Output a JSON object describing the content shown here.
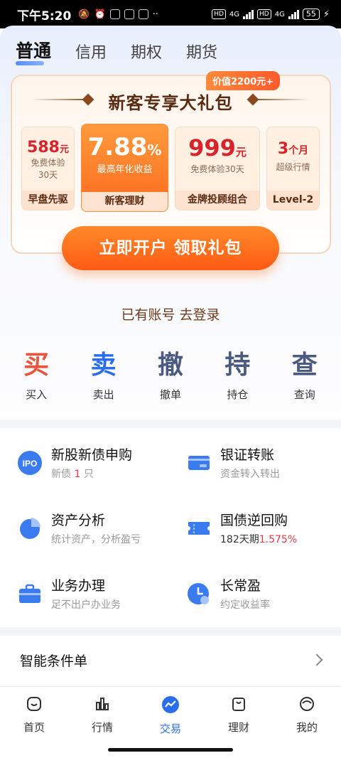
{
  "status": {
    "time": "下午5:20",
    "net1": "4G",
    "net2": "4G",
    "hd": "HD",
    "battery": "55"
  },
  "tabs": [
    {
      "label": "普通"
    },
    {
      "label": "信用"
    },
    {
      "label": "期权"
    },
    {
      "label": "期货"
    }
  ],
  "promo": {
    "badge": "价值2200元+",
    "title": "新客专享大礼包",
    "offers": [
      {
        "big": "588",
        "unit": "元",
        "sub1": "免费体验",
        "sub2": "30天",
        "foot": "早盘先驱"
      },
      {
        "big": "7.88",
        "unit": "%",
        "sub1": "最高年化收益",
        "sub2": "",
        "foot": "新客理财"
      },
      {
        "big": "999",
        "unit": "元",
        "sub1": "免费体验30天",
        "sub2": "",
        "foot": "金牌投顾组合"
      },
      {
        "big": "3",
        "unit": "个月",
        "sub1": "超级行情",
        "sub2": "",
        "foot": "Level-2"
      }
    ],
    "cta": "立即开户 领取礼包",
    "login": "已有账号 去登录"
  },
  "quick": [
    {
      "glyph": "买",
      "label": "买入",
      "color": "#e8553a"
    },
    {
      "glyph": "卖",
      "label": "卖出",
      "color": "#2a6ee8"
    },
    {
      "glyph": "撤",
      "label": "撤单",
      "color": "#4a5a80"
    },
    {
      "glyph": "持",
      "label": "持仓",
      "color": "#4a5a80"
    },
    {
      "glyph": "查",
      "label": "查询",
      "color": "#4a5a80"
    }
  ],
  "services": [
    {
      "title": "新股新债申购",
      "sub_prefix": "新债 ",
      "sub_hl": "1",
      "sub_suffix": " 只",
      "icon": "ipo-icon",
      "icon_text": "IPO"
    },
    {
      "title": "银证转账",
      "sub_prefix": "资金转入转出",
      "sub_hl": "",
      "sub_suffix": "",
      "icon": "bank-card-icon"
    },
    {
      "title": "资产分析",
      "sub_prefix": "统计资产，分析盈亏",
      "sub_hl": "",
      "sub_suffix": "",
      "icon": "pie-chart-icon"
    },
    {
      "title": "国债逆回购",
      "sub_prefix": "182天期",
      "sub_hl": "1.575%",
      "sub_suffix": "",
      "icon": "ticket-icon"
    },
    {
      "title": "业务办理",
      "sub_prefix": "足不出户办业务",
      "sub_hl": "",
      "sub_suffix": "",
      "icon": "briefcase-icon"
    },
    {
      "title": "长常盈",
      "sub_prefix": "约定收益率",
      "sub_hl": "",
      "sub_suffix": "",
      "icon": "clock-coin-icon"
    }
  ],
  "condition": {
    "label": "智能条件单"
  },
  "tabbar": [
    {
      "label": "首页",
      "icon": "home-icon"
    },
    {
      "label": "行情",
      "icon": "market-icon"
    },
    {
      "label": "交易",
      "icon": "trade-icon"
    },
    {
      "label": "理财",
      "icon": "wealth-icon"
    },
    {
      "label": "我的",
      "icon": "profile-icon"
    }
  ]
}
